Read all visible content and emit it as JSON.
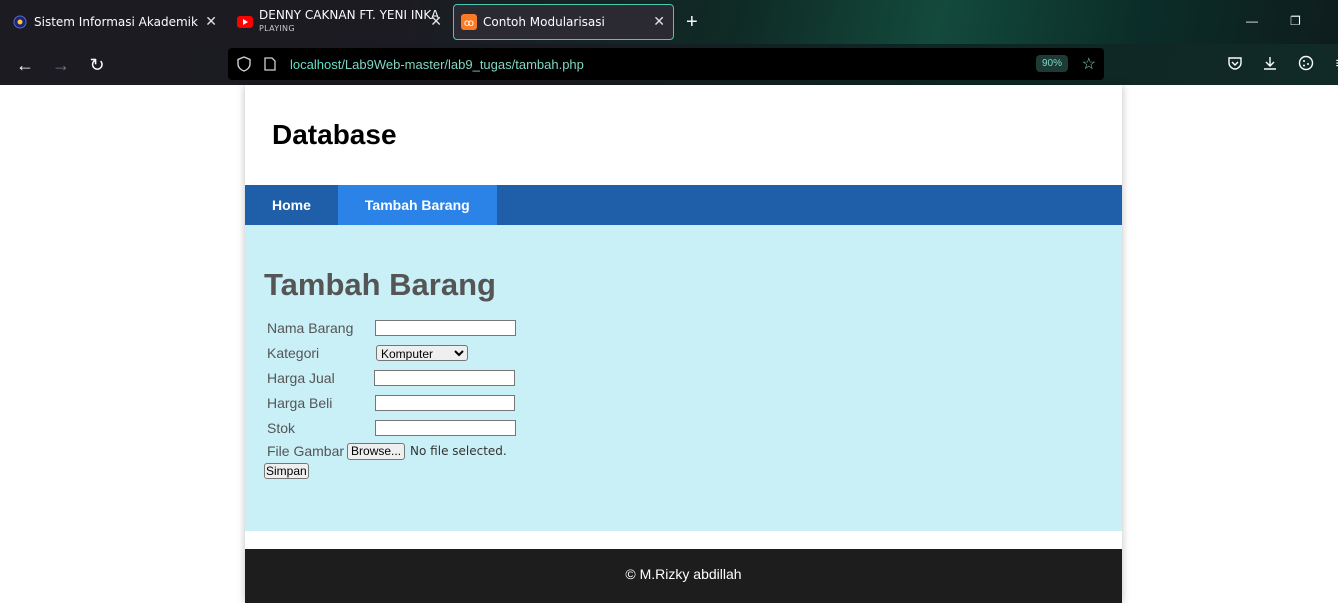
{
  "browser": {
    "tabs": [
      {
        "title": "Sistem Informasi Akademik",
        "icon": "university-icon",
        "active": false
      },
      {
        "title": "DENNY CAKNAN FT. YENI INKA",
        "subtitle": "PLAYING",
        "icon": "youtube-icon",
        "active": false
      },
      {
        "title": "Contoh Modularisasi",
        "icon": "xampp-icon",
        "active": true
      }
    ],
    "url_host": "localhost",
    "url_path": "/Lab9Web-master/lab9_tugas/tambah.php",
    "zoom": "90%"
  },
  "site": {
    "title": "Database",
    "nav": [
      {
        "label": "Home",
        "active": false
      },
      {
        "label": "Tambah Barang",
        "active": true
      }
    ],
    "page_heading": "Tambah Barang",
    "form": {
      "nama_label": "Nama Barang",
      "kategori_label": "Kategori",
      "kategori_selected": "Komputer",
      "harga_jual_label": "Harga Jual",
      "harga_beli_label": "Harga Beli",
      "stok_label": "Stok",
      "file_label": "File Gambar",
      "browse_label": "Browse...",
      "no_file_text": "No file selected.",
      "submit_label": "Simpan"
    },
    "footer": "© M.Rizky abdillah"
  }
}
